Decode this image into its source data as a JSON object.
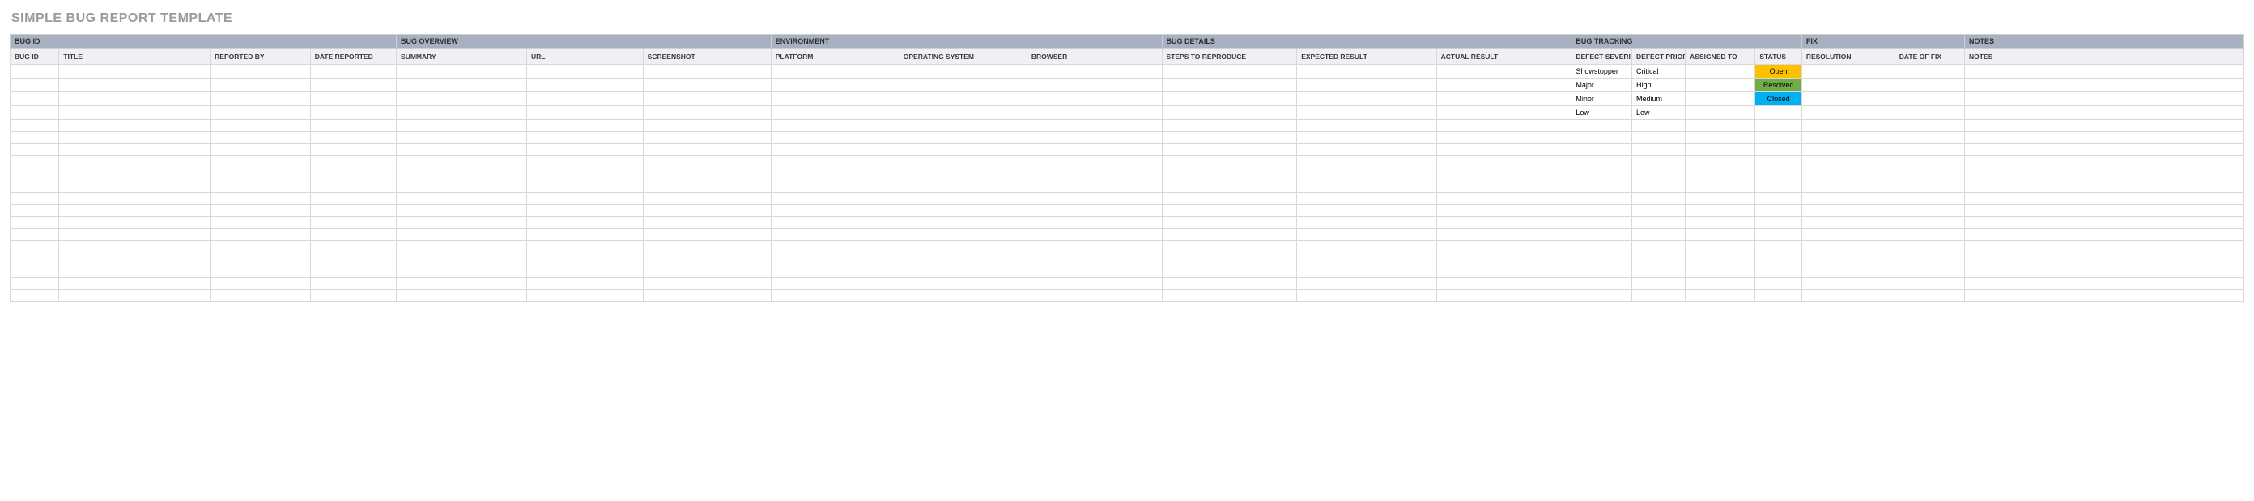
{
  "title": "SIMPLE BUG REPORT TEMPLATE",
  "groups": {
    "bug_id": "BUG ID",
    "bug_overview": "BUG OVERVIEW",
    "environment": "ENVIRONMENT",
    "bug_details": "BUG DETAILS",
    "bug_tracking": "BUG TRACKING",
    "fix": "FIX",
    "notes": "NOTES"
  },
  "headers": {
    "bug_id": "BUG ID",
    "title": "TITLE",
    "reported_by": "REPORTED BY",
    "date_reported": "DATE REPORTED",
    "summary": "SUMMARY",
    "url": "URL",
    "screenshot": "SCREENSHOT",
    "platform": "PLATFORM",
    "operating_system": "OPERATING SYSTEM",
    "browser": "BROWSER",
    "steps_to_reproduce": "STEPS TO REPRODUCE",
    "expected_result": "EXPECTED RESULT",
    "actual_result": "ACTUAL RESULT",
    "defect_severity": "DEFECT SEVERITY",
    "defect_priority": "DEFECT PRIORITY",
    "assigned_to": "ASSIGNED TO",
    "status": "STATUS",
    "resolution": "RESOLUTION",
    "date_of_fix": "DATE OF FIX",
    "notes": "NOTES"
  },
  "rows": [
    {
      "severity": "Showstopper",
      "priority": "Critical",
      "status": "Open",
      "status_class": "status-open"
    },
    {
      "severity": "Major",
      "priority": "High",
      "status": "Resolved",
      "status_class": "status-resolved"
    },
    {
      "severity": "Minor",
      "priority": "Medium",
      "status": "Closed",
      "status_class": "status-closed"
    },
    {
      "severity": "Low",
      "priority": "Low",
      "status": "",
      "status_class": ""
    },
    {},
    {},
    {},
    {},
    {},
    {},
    {},
    {},
    {},
    {},
    {},
    {},
    {},
    {},
    {}
  ]
}
